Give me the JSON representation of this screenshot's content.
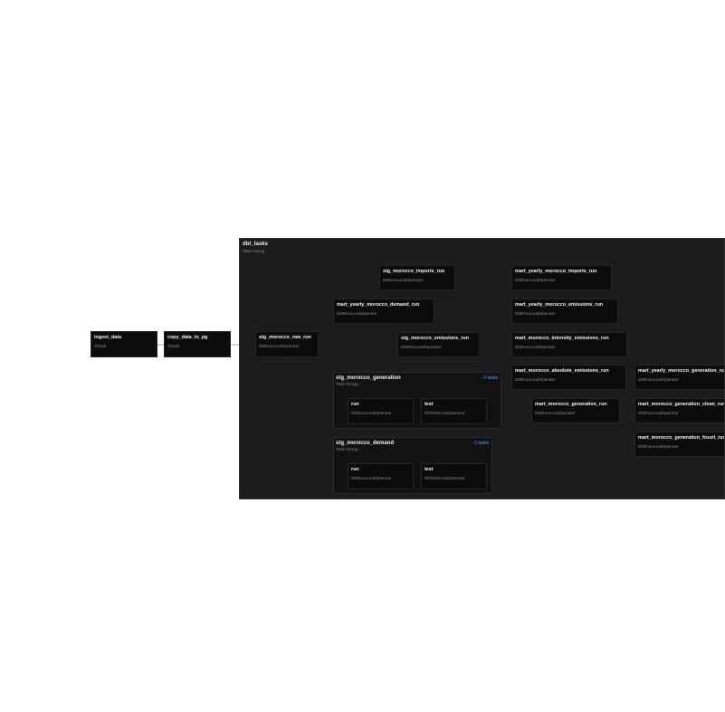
{
  "tasks": {
    "ingest_data": {
      "label": "ingest_data",
      "sub": "@task"
    },
    "copy_data_to_pg": {
      "label": "copy_data_to_pg",
      "sub": "@task"
    }
  },
  "group": {
    "title": "dbt_tasks",
    "sub": "Task Group"
  },
  "nodes": {
    "stg_raw": {
      "label": "stg_morocco_raw_run",
      "sub": "DbtRunLocalOperator"
    },
    "stg_imports": {
      "label": "stg_morocco_imports_run",
      "sub": "DbtRunLocalOperator"
    },
    "mart_demand": {
      "label": "mart_yearly_morocco_demand_run",
      "sub": "DbtRunLocalOperator"
    },
    "stg_emissions": {
      "label": "stg_morocco_emissions_run",
      "sub": "DbtRunLocalOperator"
    },
    "mart_imports": {
      "label": "mart_yearly_morocco_imports_run",
      "sub": "DbtRunLocalOperator"
    },
    "mart_emissions": {
      "label": "mart_yearly_morocco_emissions_run",
      "sub": "DbtRunLocalOperator"
    },
    "mart_intensity": {
      "label": "mart_morocco_intensity_emissions_run",
      "sub": "DbtRunLocalOperator"
    },
    "mart_absolute": {
      "label": "mart_morocco_absolute_emissions_run",
      "sub": "DbtRunLocalOperator"
    },
    "mart_generation": {
      "label": "mart_morocco_generation_run",
      "sub": "DbtRunLocalOperator"
    },
    "mart_yearly_generation": {
      "label": "mart_yearly_morocco_generation_run",
      "sub": "DbtRunLocalOperator"
    },
    "mart_generation_clean": {
      "label": "mart_morocco_generation_clean_run",
      "sub": "DbtRunLocalOperator"
    },
    "mart_generation_fossil": {
      "label": "mart_morocco_generation_fossil_run",
      "sub": "DbtRunLocalOperator"
    }
  },
  "subgroups": {
    "generation": {
      "title": "stg_morocco_generation",
      "sub": "Task Group",
      "count": "- 2 tasks",
      "run": {
        "label": "run",
        "sub": "DbtRunLocalOperator"
      },
      "test": {
        "label": "test",
        "sub": "DbtTestLocalOperator"
      }
    },
    "demand": {
      "title": "stg_morocco_demand",
      "sub": "Task Group",
      "count": "- 2 tasks",
      "run": {
        "label": "run",
        "sub": "DbtRunLocalOperator"
      },
      "test": {
        "label": "test",
        "sub": "DbtTestLocalOperator"
      }
    }
  },
  "colors": {
    "canvas": "#ffffff",
    "group_bg": "#1c1c1e",
    "node_bg": "#0c0c0d",
    "edge": "#8a8a8a",
    "count_accent": "#5aa0ff"
  }
}
